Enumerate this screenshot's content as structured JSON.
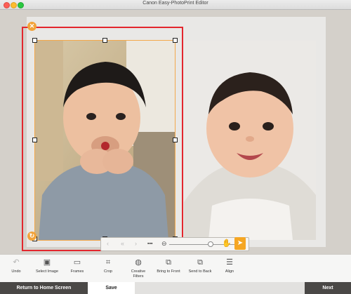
{
  "window": {
    "title": "Canon Easy-PhotoPrint Editor"
  },
  "toolbar": {
    "items": [
      {
        "label": "Undo",
        "icon": "undo-icon"
      },
      {
        "label": "Select Image",
        "icon": "select-image-icon"
      },
      {
        "label": "Frames",
        "icon": "frames-icon"
      },
      {
        "label": "Crop",
        "icon": "crop-icon"
      },
      {
        "label": "Creative\nFilters",
        "icon": "creative-filters-icon"
      },
      {
        "label": "Bring to Front",
        "icon": "bring-to-front-icon"
      },
      {
        "label": "Send to Back",
        "icon": "send-to-back-icon"
      },
      {
        "label": "Align",
        "icon": "align-icon"
      }
    ]
  },
  "zoom": {
    "level": 0.6
  },
  "bottom": {
    "home_label": "Return to Home Screen",
    "save_label": "Save",
    "next_label": "Next"
  },
  "colors": {
    "selection_red": "#e3262d",
    "accent_orange": "#f3a84b"
  }
}
